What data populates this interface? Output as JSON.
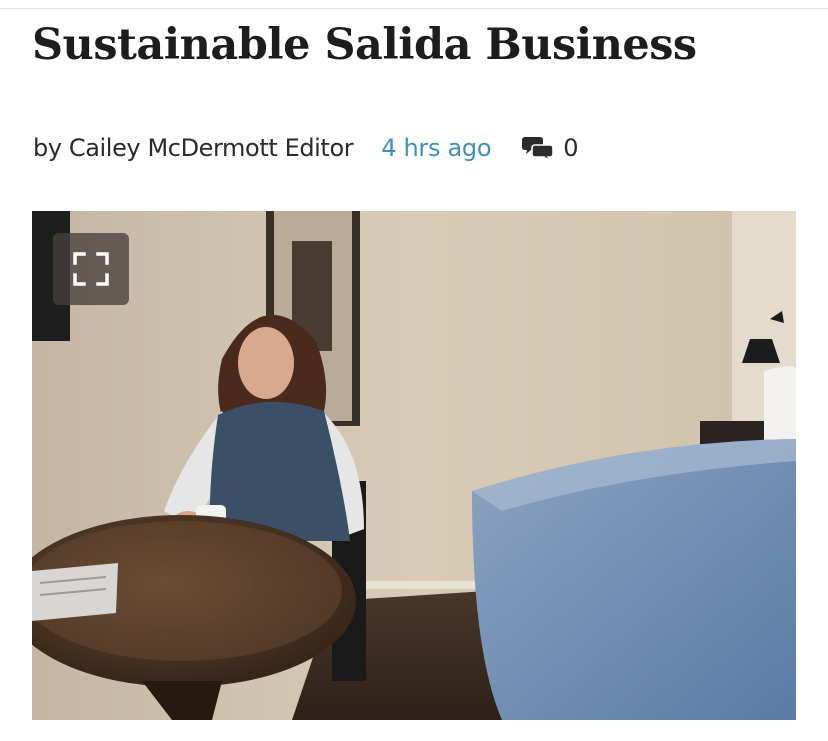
{
  "article": {
    "headline": "Sustainable Salida Business",
    "byline": "by Cailey McDermott Editor",
    "timestamp": "4 hrs ago",
    "comment_count": "0"
  },
  "icons": {
    "comment": "comment-bubbles-icon",
    "expand": "expand-fullscreen-icon"
  },
  "colors": {
    "headline": "#1d1d1d",
    "timestamp": "#3f8fc2",
    "text": "#2b2b2b"
  }
}
